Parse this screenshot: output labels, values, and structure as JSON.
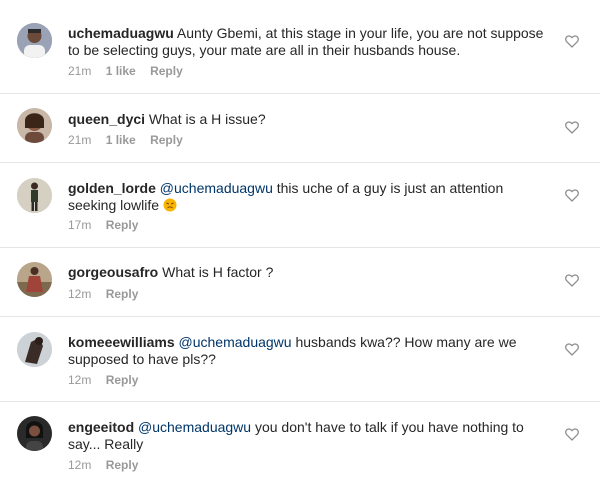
{
  "comments": [
    {
      "username": "uchemaduagwu",
      "mention": "",
      "text": "Aunty Gbemi, at this stage in your life, you are not suppose to be selecting guys, your mate are all in their husbands house.",
      "time": "21m",
      "likes": "1 like",
      "reply": "Reply",
      "avatar_icon": "avatar-man-portrait-icon"
    },
    {
      "username": "queen_dyci",
      "mention": "",
      "text": "What is a H issue?",
      "time": "21m",
      "likes": "1 like",
      "reply": "Reply",
      "avatar_icon": "avatar-woman-portrait-icon"
    },
    {
      "username": "golden_lorde",
      "mention": "@uchemaduagwu",
      "text": "this uche of a guy is just an attention seeking lowlife",
      "emoji": "angry-face-emoji",
      "time": "17m",
      "likes": "",
      "reply": "Reply",
      "avatar_icon": "avatar-standing-figure-icon"
    },
    {
      "username": "gorgeousafro",
      "mention": "",
      "text": "What is H factor ?",
      "time": "12m",
      "likes": "",
      "reply": "Reply",
      "avatar_icon": "avatar-outdoor-figure-icon"
    },
    {
      "username": "komeeewilliams",
      "mention": "@uchemaduagwu",
      "text": "husbands kwa?? How many are we supposed to have pls??",
      "time": "12m",
      "likes": "",
      "reply": "Reply",
      "avatar_icon": "avatar-dark-figure-icon"
    },
    {
      "username": "engeeitod",
      "mention": "@uchemaduagwu",
      "text": "you don't have to talk if you have nothing to say... Really",
      "time": "12m",
      "likes": "",
      "reply": "Reply",
      "avatar_icon": "avatar-woman-dark-icon"
    }
  ],
  "colors": {
    "text": "#262626",
    "mention": "#003569",
    "meta": "#999999",
    "divider": "#e6e6e6"
  }
}
